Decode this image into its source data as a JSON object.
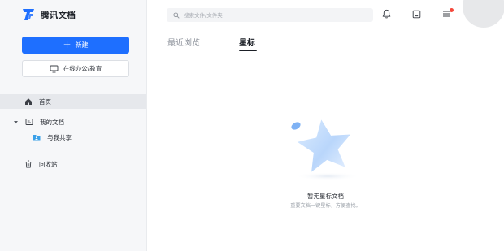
{
  "app": {
    "name": "腾讯文档",
    "brand_color": "#1e6fff"
  },
  "sidebar": {
    "new_button_label": "新建",
    "office_button_label": "在线办公/教育",
    "items": [
      {
        "label": "首页",
        "icon": "home-icon",
        "active": true
      },
      {
        "label": "我的文档",
        "icon": "folder-doc-icon",
        "expanded": true
      },
      {
        "label": "与我共享",
        "icon": "shared-folder-icon"
      },
      {
        "label": "回收站",
        "icon": "trash-icon"
      }
    ]
  },
  "header": {
    "search_placeholder": "搜索文件/文件夹",
    "notification_dot_color": "#f5483b"
  },
  "tabs": [
    {
      "label": "最近浏览",
      "active": false
    },
    {
      "label": "星标",
      "active": true
    }
  ],
  "empty_state": {
    "title": "暂无星标文档",
    "subtitle": "重要文档一键星标，方便查找。",
    "icon": "star-icon"
  }
}
